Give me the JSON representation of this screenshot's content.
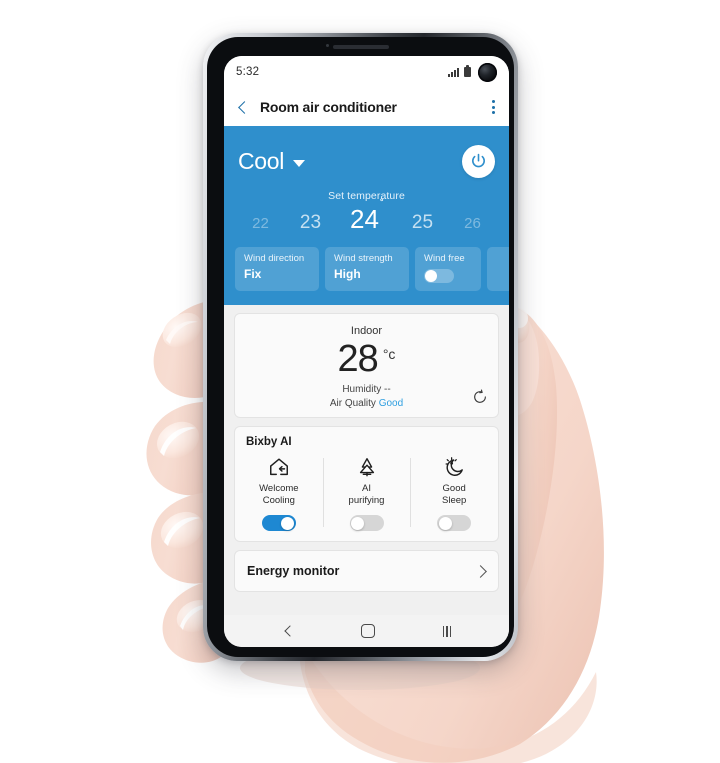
{
  "status_bar": {
    "time": "5:32",
    "icons": [
      "signal-bars-icon",
      "battery-icon",
      "front-camera-hole"
    ]
  },
  "app_bar": {
    "back_icon": "back-chevron-icon",
    "title": "Room air conditioner",
    "menu_icon": "kebab-menu-icon"
  },
  "control_panel": {
    "mode": "Cool",
    "mode_caret_icon": "chevron-down-icon",
    "power_icon": "power-icon",
    "accent_color": "#2f8fcc",
    "set_temperature_label": "Set temperature",
    "temperature_scale": [
      "22",
      "23",
      "24",
      "25",
      "26"
    ],
    "selected_temperature": "24",
    "degree_symbol": "˚",
    "tiles": [
      {
        "label": "Wind direction",
        "value": "Fix",
        "type": "value"
      },
      {
        "label": "Wind strength",
        "value": "High",
        "type": "value"
      },
      {
        "label": "Wind free",
        "value": "",
        "type": "toggle",
        "on": false
      }
    ]
  },
  "indoor_card": {
    "title": "Indoor",
    "temperature": "28",
    "unit": "°c",
    "humidity": "Humidity --",
    "air_quality_label": "Air Quality",
    "air_quality_value": "Good",
    "air_quality_color": "#2f9fe0",
    "refresh_icon": "refresh-icon"
  },
  "bixby_card": {
    "title": "Bixby AI",
    "items": [
      {
        "icon": "welcome-home-icon",
        "line1": "Welcome",
        "line2": "Cooling",
        "on": true
      },
      {
        "icon": "air-purify-icon",
        "line1": "AI",
        "line2": "purifying",
        "on": false
      },
      {
        "icon": "good-sleep-moon-icon",
        "line1": "Good",
        "line2": "Sleep",
        "on": false
      }
    ]
  },
  "energy_row": {
    "label": "Energy monitor",
    "chevron_icon": "chevron-right-icon"
  },
  "nav_bar": {
    "back_icon": "nav-back-icon",
    "home_icon": "nav-home-icon",
    "recents_icon": "nav-recents-icon"
  }
}
